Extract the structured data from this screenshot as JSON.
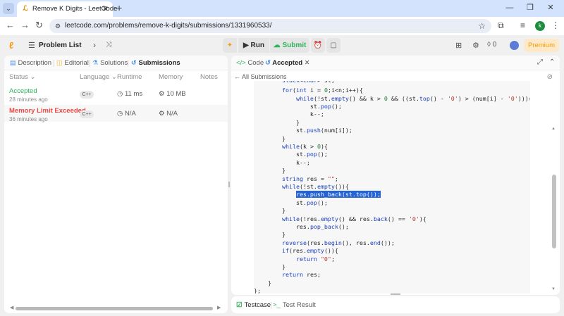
{
  "browser": {
    "tab_title": "Remove K Digits - LeetCode",
    "url": "leetcode.com/problems/remove-k-digits/submissions/1331960533/",
    "profile_initial": "k"
  },
  "header": {
    "problem_list_label": "Problem List",
    "run_label": "Run",
    "submit_label": "Submit",
    "streak_count": "0",
    "premium_label": "Premium"
  },
  "left_tabs": {
    "description": "Description",
    "editorial": "Editorial",
    "solutions": "Solutions",
    "submissions": "Submissions"
  },
  "columns": {
    "status": "Status",
    "language": "Language",
    "runtime": "Runtime",
    "memory": "Memory",
    "notes": "Notes"
  },
  "submissions": [
    {
      "status": "Accepted",
      "time_ago": "28 minutes ago",
      "language": "C++",
      "runtime": "11 ms",
      "memory": "10 MB"
    },
    {
      "status": "Memory Limit Exceeded",
      "time_ago": "36 minutes ago",
      "language": "C++",
      "runtime": "N/A",
      "memory": "N/A"
    }
  ],
  "right_tabs": {
    "code": "Code",
    "accepted": "Accepted",
    "back_label": "All Submissions"
  },
  "bottom_tabs": {
    "testcase": "Testcase",
    "test_result": "Test Result"
  },
  "colors": {
    "accepted": "#2db55d",
    "error": "#ef4743",
    "premium": "#f59e0b",
    "selection": "#2463d6"
  }
}
